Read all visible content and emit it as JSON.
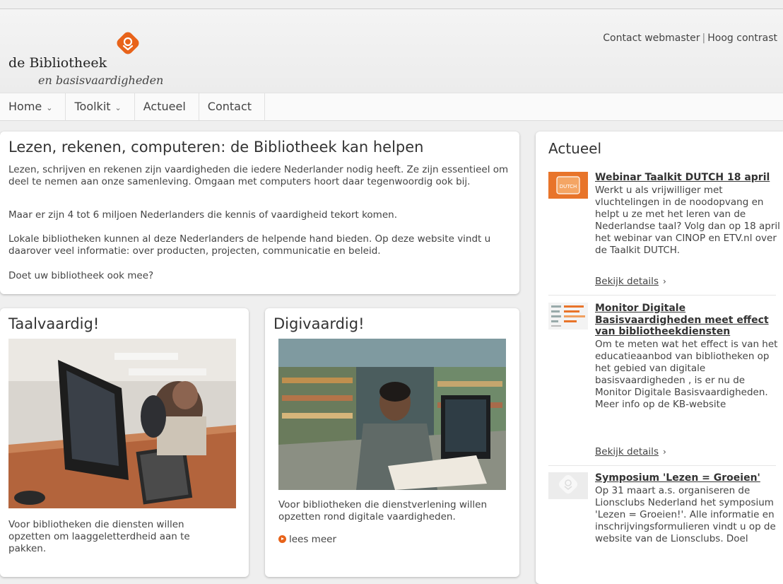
{
  "header": {
    "logo_title": "de Bibliotheek",
    "logo_subtitle": "en basisvaardigheden",
    "links": [
      "Contact webmaster",
      "Hoog contrast"
    ],
    "brand_color": "#e8631a"
  },
  "nav": {
    "items": [
      {
        "label": "Home",
        "has_dropdown": true
      },
      {
        "label": "Toolkit",
        "has_dropdown": true
      },
      {
        "label": "Actueel",
        "has_dropdown": false
      },
      {
        "label": "Contact",
        "has_dropdown": false
      }
    ]
  },
  "intro": {
    "title": "Lezen, rekenen, computeren: de Bibliotheek kan helpen",
    "paragraphs": [
      "Lezen, schrijven en rekenen zijn vaardigheden die iedere Nederlander nodig heeft. Ze zijn essentieel om deel te nemen aan onze samenleving. Omgaan met computers hoort daar tegenwoordig ook bij.",
      "Maar er zijn 4 tot 6 miljoen Nederlanders die kennis of vaardigheid tekort komen.",
      "Lokale bibliotheken kunnen al deze Nederlanders de helpende hand bieden. Op deze website vindt u daarover veel informatie: over producten, projecten, communicatie en beleid.",
      "Doet uw bibliotheek ook mee?"
    ]
  },
  "tiles": [
    {
      "title": "Taalvaardig!",
      "text": "Voor bibliotheken die diensten willen opzetten om laaggeletterdheid aan te pakken.",
      "image": "photo-computer-classroom"
    },
    {
      "title": "Digivaardig!",
      "text": "Voor bibliotheken die dienstverlening willen opzetten rond digitale vaardigheden.",
      "more_label": "lees meer",
      "image": "photo-student-library"
    }
  ],
  "actueel": {
    "title": "Actueel",
    "details_label": "Bekijk details",
    "items": [
      {
        "title": "Webinar Taalkit DUTCH 18 april",
        "body": "Werkt u als vrijwilliger met vluchtelingen in de noodopvang en helpt u ze met het leren van de Nederlandse taal? Volg dan op 18 april het webinar van CINOP en ETV.nl over de Taalkit DUTCH.",
        "thumb_text": "DUTCH"
      },
      {
        "title": "Monitor Digitale Basisvaardigheden meet effect van bibliotheekdiensten",
        "body": "Om te meten wat het effect is van het educatieaanbod van bibliotheken op het gebied van digitale basisvaardigheden , is er nu de Monitor Digitale Basisvaardigheden. Meer info op de KB-website"
      },
      {
        "title": "Symposium 'Lezen = Groeien'",
        "body": "Op 31 maart a.s. organiseren de Lionsclubs Nederland het symposium 'Lezen = Groeien!'. Alle informatie en inschrijvingsformulieren vindt u op de website van de Lionsclubs. Doel"
      }
    ]
  }
}
